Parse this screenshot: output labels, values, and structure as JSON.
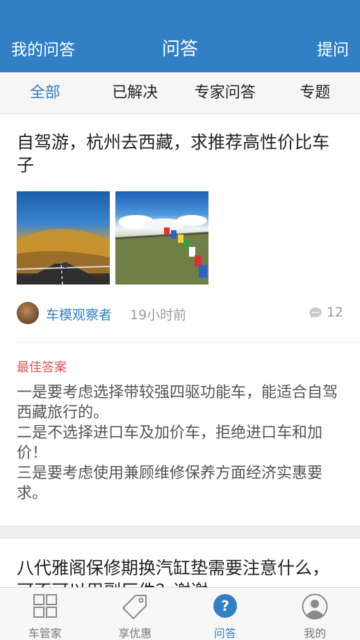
{
  "header": {
    "left": "我的问答",
    "title": "问答",
    "right": "提问"
  },
  "tabs": [
    "全部",
    "已解决",
    "专家问答",
    "专题"
  ],
  "active_tab": "全部",
  "posts": [
    {
      "title": "自驾游，杭州去西藏，求推荐高性价比车子",
      "images": [
        "desert-road-photo",
        "prayer-flags-photo"
      ],
      "author": "车模观察者",
      "time": "19小时前",
      "comment_count": "12",
      "best_answer_label": "最佳答案",
      "best_answer_lines": [
        "一是要考虑选择带较强四驱功能车，能适合自驾西藏旅行的。",
        "二是不选择进口车及加价车，拒绝进口车和加价！",
        "三是要考虑使用兼顾维修保养方面经济实惠要求。"
      ]
    },
    {
      "title": "八代雅阁保修期换汽缸垫需要注意什么，可不可以用副厂件？谢谢"
    }
  ],
  "bottom_nav": [
    {
      "label": "车管家",
      "icon": "grid-icon"
    },
    {
      "label": "享优惠",
      "icon": "tag-icon"
    },
    {
      "label": "问答",
      "icon": "question-icon"
    },
    {
      "label": "我的",
      "icon": "user-icon"
    }
  ],
  "colors": {
    "primary": "#3180c6",
    "best_answer": "#e05454",
    "muted": "#999999"
  }
}
